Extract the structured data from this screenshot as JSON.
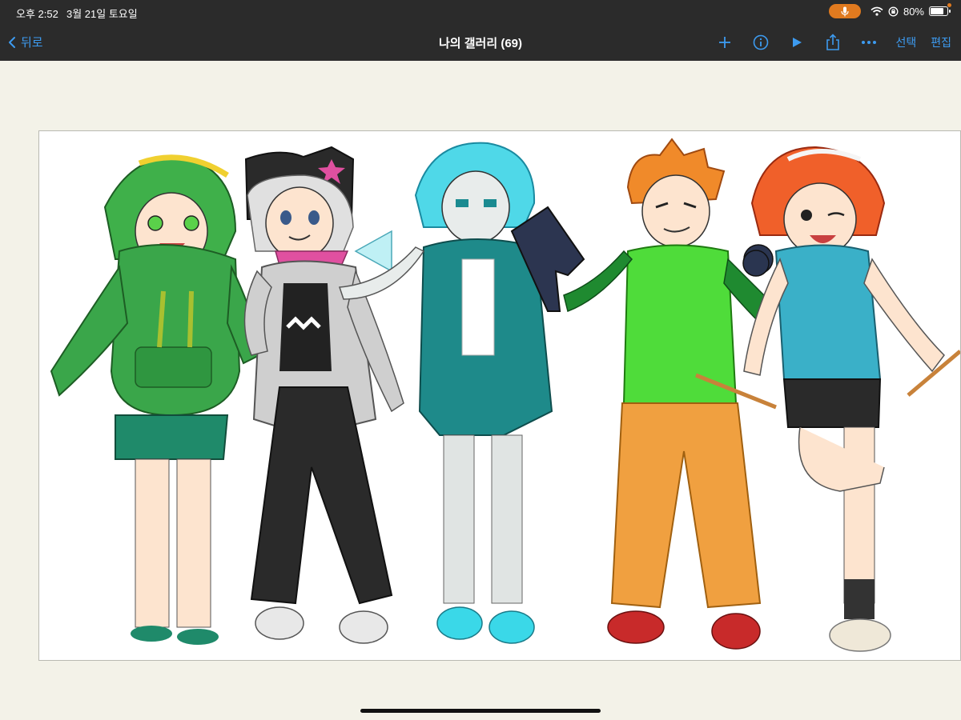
{
  "status_bar": {
    "time": "오후 2:52",
    "date": "3월 21일 토요일",
    "battery_percent": "80%",
    "battery_level": 0.8
  },
  "nav": {
    "back_label": "뒤로",
    "title": "나의 갤러리 (69)",
    "select_label": "선택",
    "edit_label": "편집",
    "icons": [
      "plus-icon",
      "info-icon",
      "play-icon",
      "share-icon",
      "more-icon"
    ]
  },
  "colors": {
    "accent": "#3d9bf0",
    "bar_background": "#2b2b2b",
    "page_background": "#f3f2e8",
    "mic_pill": "#e07a1f"
  },
  "artwork": {
    "characters": [
      {
        "name": "green-hoodie-character",
        "hair": "#3fb04a",
        "top": "#3aa64a",
        "bottom": "#1f8a6a"
      },
      {
        "name": "grey-hair-character",
        "hair": "#d9d9d9",
        "top": "#cfcfcf",
        "bottom": "#2a2a2a"
      },
      {
        "name": "cyan-hair-character",
        "hair": "#4fd8e8",
        "top": "#1e8a8a",
        "bottom": "#1e8a8a"
      },
      {
        "name": "orange-hair-character",
        "hair": "#f08a2a",
        "top": "#4fdc3a",
        "bottom": "#f0a040"
      },
      {
        "name": "red-hair-character",
        "hair": "#f0602a",
        "top": "#3ab0c8",
        "bottom": "#2a2a2a"
      }
    ]
  }
}
